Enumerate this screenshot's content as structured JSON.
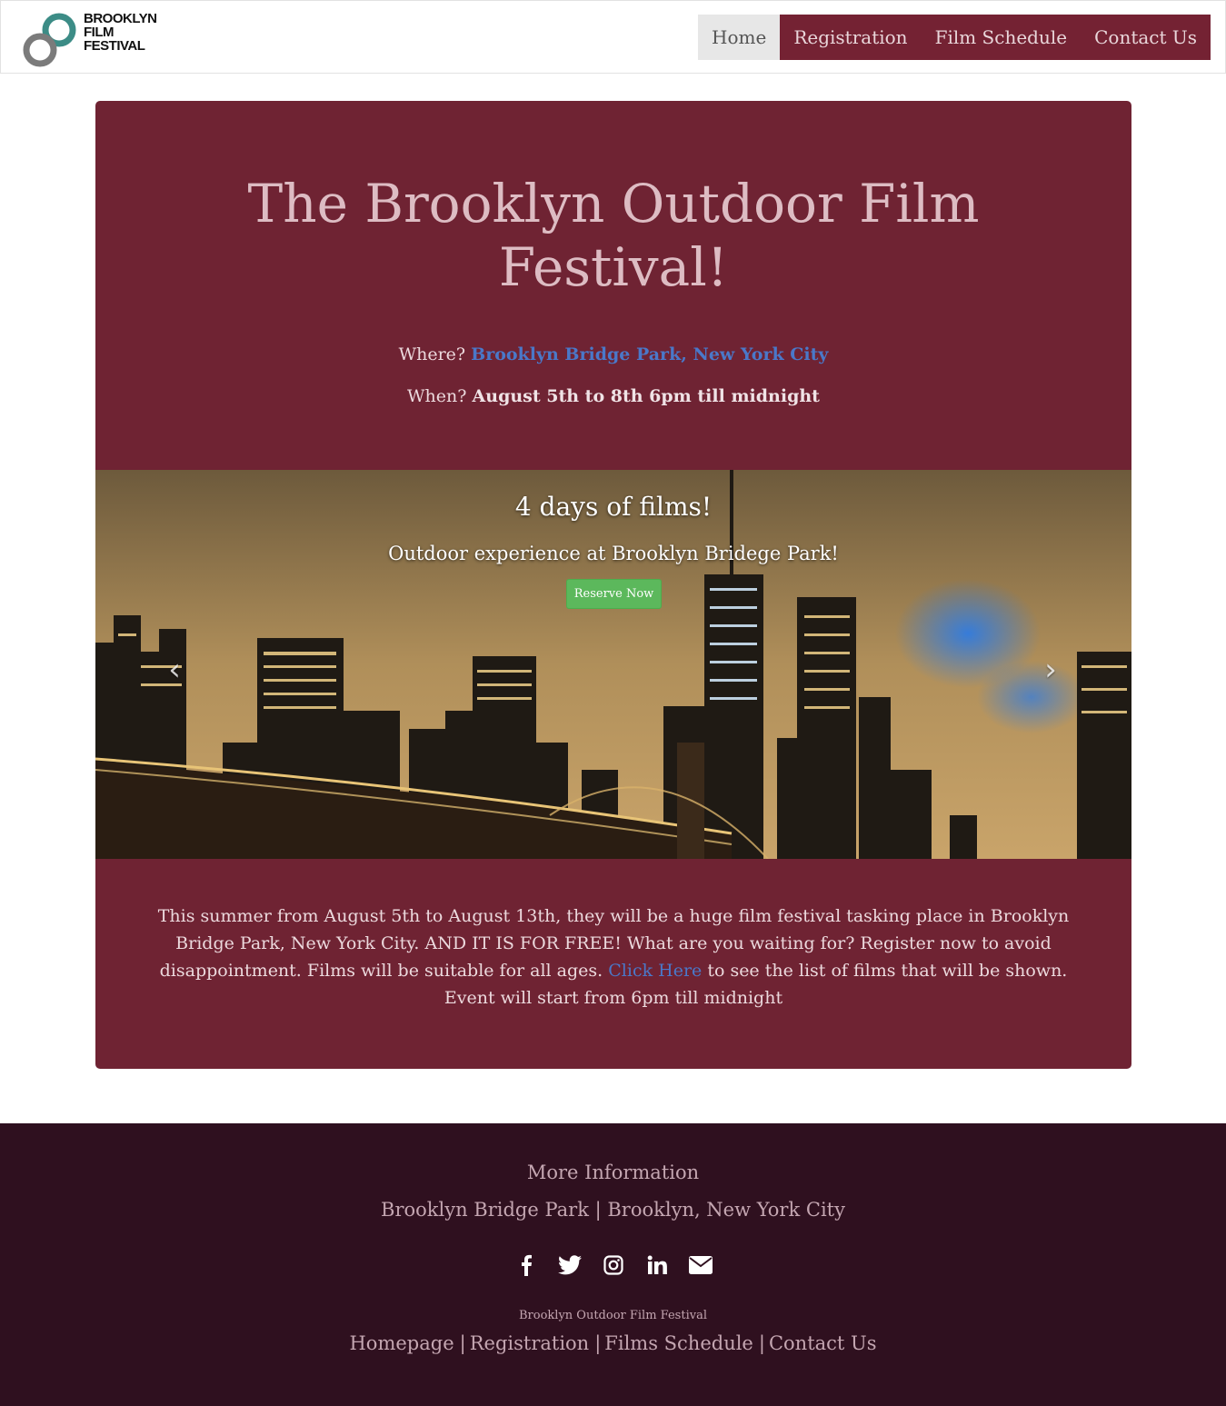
{
  "brand": {
    "line1": "BROOKLYN",
    "line2": "FILM",
    "line3": "FESTIVAL"
  },
  "nav": [
    {
      "label": "Home"
    },
    {
      "label": "Registration"
    },
    {
      "label": "Film Schedule"
    },
    {
      "label": "Contact Us"
    }
  ],
  "hero": {
    "title": "The Brooklyn Outdoor Film Festival!",
    "where_label": "Where?",
    "where_value": "Brooklyn Bridge Park, New York City",
    "when_label": "When?",
    "when_value": "August 5th to 8th 6pm till midnight"
  },
  "carousel": {
    "title": "4 days of films!",
    "subtitle": "Outdoor experience at Brooklyn Bridege Park!",
    "button": "Reserve Now",
    "prev_icon": "chevron-left-icon",
    "next_icon": "chevron-right-icon"
  },
  "summary": {
    "before_link": "This summer from August 5th to August 13th, they will be a huge film festival tasking place in Brooklyn Bridge Park, New York City. AND IT IS FOR FREE! What are you waiting for? Register now to avoid disappointment. Films will be suitable for all ages.",
    "link": "Click Here",
    "after_link": "to see the list of films that will be shown. Event will start from 6pm till midnight"
  },
  "footer": {
    "title": "More Information",
    "address": "Brooklyn Bridge Park | Brooklyn, New York City",
    "socials": [
      "facebook-icon",
      "twitter-icon",
      "instagram-icon",
      "linkedin-icon",
      "envelope-icon"
    ],
    "small": "Brooklyn Outdoor Film Festival",
    "links": [
      "Homepage",
      "Registration",
      "Films Schedule",
      "Contact Us"
    ]
  },
  "colors": {
    "brand": "#6f2333",
    "nav": "#742233",
    "footer": "#2f101f",
    "link": "#4a78c9",
    "button": "#5cb85c"
  }
}
